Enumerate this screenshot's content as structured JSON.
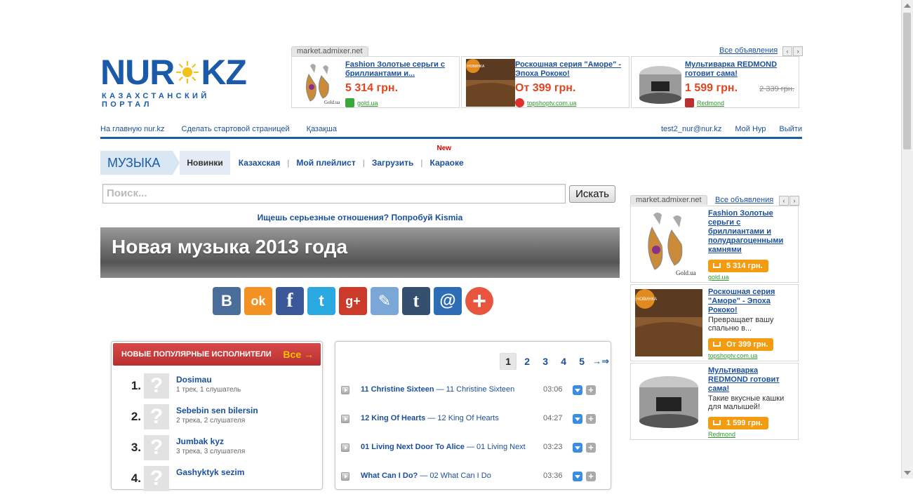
{
  "logo": {
    "left": "NUR",
    "right": "KZ",
    "tagline": "КАЗАХСТАНСКИЙ ПОРТАЛ"
  },
  "top_ad": {
    "label": "market.admixer.net",
    "all_link": "Все объявления",
    "prev_icon": "‹",
    "next_icon": "›",
    "cards": [
      {
        "title": "Fashion Золотые серьги с бриллиантами и...",
        "price": "5 314 грн.",
        "old_price": "",
        "source": "gold.ua",
        "source_color": "#3aa83a"
      },
      {
        "title": "Роскошная серия \"Аморе\" - Эпоха Рококо!",
        "price": "От 399 грн.",
        "old_price": "",
        "source": "topshoptv.com.ua",
        "source_color": "#e03030"
      },
      {
        "title": "Мультиварка REDMOND готовит сама!",
        "price": "1 599 грн.",
        "old_price": "2 339 грн.",
        "source": "Redmond",
        "source_color": "#b83030"
      }
    ]
  },
  "topnav": {
    "home": "На главную nur.kz",
    "make_start": "Сделать стартовой страницей",
    "kazakh": "Қазақша",
    "email": "test2_nur@nur.kz",
    "my_nur": "Мой Нур",
    "logout": "Выйти"
  },
  "music_menu": {
    "title": "МУЗЫКА",
    "tabs": [
      "Новинки",
      "Казахская",
      "Мой плейлист",
      "Загрузить",
      "Караоке"
    ],
    "new_badge": "New"
  },
  "search": {
    "placeholder": "Поиск...",
    "button": "Искать"
  },
  "kismia": "Ищешь серьезные отношения? Попробуй Kismia",
  "banner_title": "Новая музыка 2013 года",
  "share": {
    "buttons": [
      {
        "name": "vk",
        "glyph": "B",
        "color": "#4a6d99"
      },
      {
        "name": "odnoklassniki",
        "glyph": "ok",
        "color": "#f39222"
      },
      {
        "name": "facebook",
        "glyph": "f",
        "color": "#3b5998"
      },
      {
        "name": "twitter",
        "glyph": "t",
        "color": "#2aa9e0"
      },
      {
        "name": "google-plus",
        "glyph": "g+",
        "color": "#cc3a2a"
      },
      {
        "name": "livejournal",
        "glyph": "✎",
        "color": "#7ba7d7"
      },
      {
        "name": "tumblr",
        "glyph": "t",
        "color": "#35506e"
      },
      {
        "name": "mail",
        "glyph": "@",
        "color": "#2d6db5"
      }
    ],
    "more": "+"
  },
  "artists": {
    "header": "НОВЫЕ ПОПУЛЯРНЫЕ ИСПОЛНИТЕЛИ",
    "all_link": "Все →",
    "items": [
      {
        "num": "1.",
        "name": "Dosimau",
        "stats": "1 трек, 1 слушатель"
      },
      {
        "num": "2.",
        "name": "Sebebin sen bilersin",
        "stats": "2 трека, 2 слушателя"
      },
      {
        "num": "3.",
        "name": "Jumbak kyz",
        "stats": "3 трека, 3 слушателя"
      },
      {
        "num": "4.",
        "name": "Gashyktyk sezim",
        "stats": ""
      }
    ]
  },
  "tracks": {
    "pages": [
      "1",
      "2",
      "3",
      "4",
      "5"
    ],
    "next": "→⇒",
    "items": [
      {
        "title": "11 Christine Sixteen",
        "sub": " — 11 Christine Sixteen",
        "duration": "03:06"
      },
      {
        "title": "12 King Of Hearts",
        "sub": " — 12 King Of Hearts",
        "duration": "04:27"
      },
      {
        "title": "01 Living Next Door To Alice",
        "sub": " — 01 Living Next",
        "duration": "03:23"
      },
      {
        "title": "What Can I Do?",
        "sub": " — 02 What Can I Do",
        "duration": "03:36"
      }
    ]
  },
  "right_ad": {
    "label": "market.admixer.net",
    "all_link": "Все объявления",
    "cards": [
      {
        "title": "Fashion Золотые серьги с бриллиантами и полудрагоценными камнями",
        "desc": "",
        "price": "5 314 грн.",
        "source": "gold.ua"
      },
      {
        "title": "Роскошная серия \"Аморе\" - Эпоха Рококо!",
        "desc": "Превращает вашу спальню в...",
        "price": "От 399 грн.",
        "source": "topshoptv.com.ua"
      },
      {
        "title": "Мультиварка REDMOND готовит сама!",
        "desc": "Такие вкусные кашки для малышей!",
        "price": "1 599 грн.",
        "source": "Redmond"
      }
    ]
  }
}
